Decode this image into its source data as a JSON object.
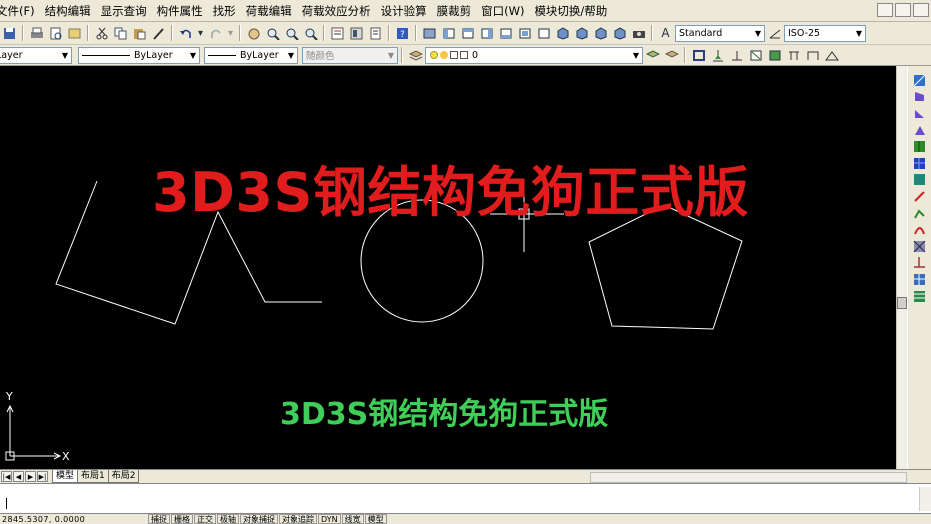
{
  "menu": [
    "文件(F)",
    "结构编辑",
    "显示查询",
    "构件属性",
    "找形",
    "荷载编辑",
    "荷载效应分析",
    "设计验算",
    "膜裁剪",
    "窗口(W)",
    "模块切换/帮助"
  ],
  "toolbar1": {
    "text_style": "Standard",
    "dim_style": "ISO-25"
  },
  "toolbar2": {
    "layer": "Layer",
    "linetype": "ByLayer",
    "lineweight": "ByLayer",
    "color": "随颜色",
    "layer_state": "0"
  },
  "watermark": {
    "big": "3D3S钢结构免狗正式版",
    "small": "3D3S钢结构免狗正式版"
  },
  "ucs": {
    "y_label": "Y",
    "x_label": "X"
  },
  "tabs": {
    "model": "模型",
    "layout1": "布局1",
    "layout2": "布局2"
  },
  "nav_buttons": [
    "|◀",
    "◀",
    "▶",
    "▶|"
  ],
  "command_line": "",
  "status": {
    "coords": "2845.5307, 0.0000",
    "buttons": [
      "捕捉",
      "栅格",
      "正交",
      "极轴",
      "对象捕捉",
      "对象追踪",
      "DYN",
      "线宽",
      "模型"
    ]
  },
  "colors": {
    "watermark_red": "#e01c1c",
    "watermark_green": "#3fcf58",
    "canvas_bg": "#000000",
    "geometry_stroke": "#ffffff"
  }
}
